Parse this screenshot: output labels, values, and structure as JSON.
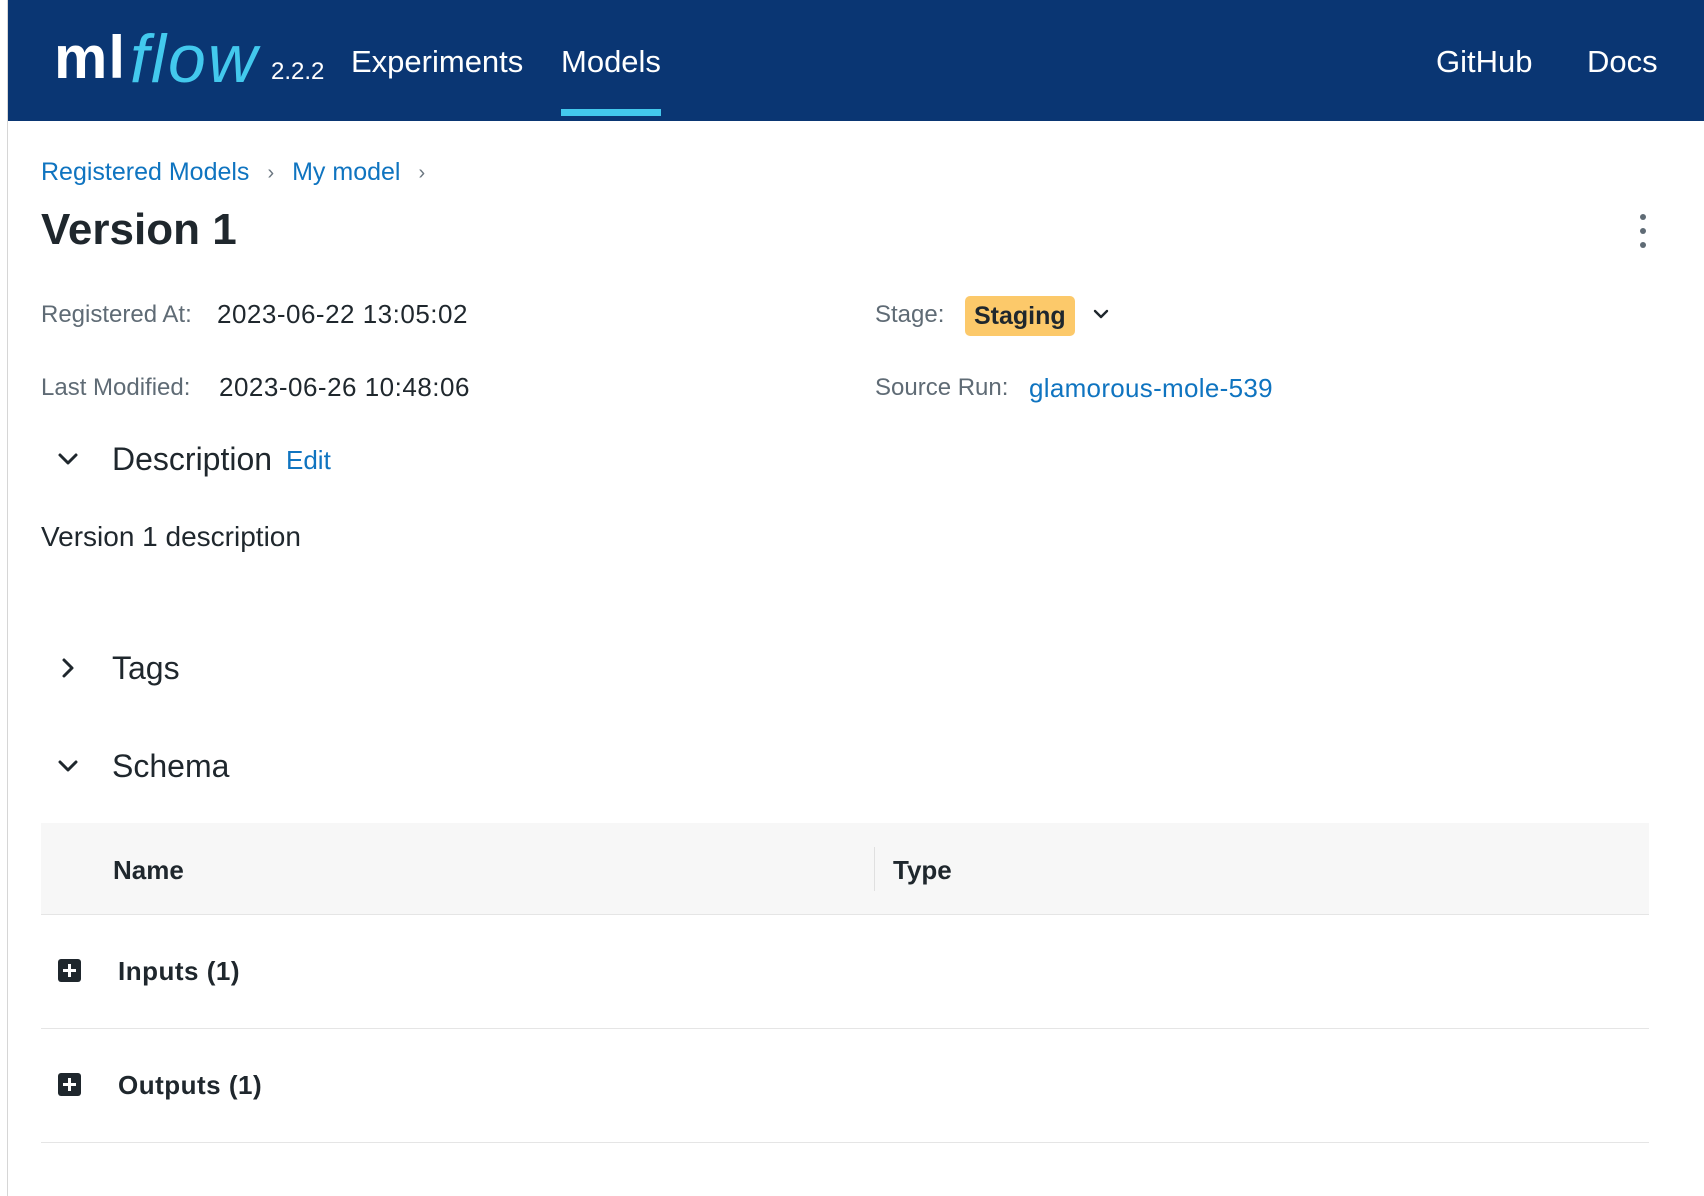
{
  "header": {
    "logo_ml": "ml",
    "logo_flow": "flow",
    "version": "2.2.2",
    "nav": {
      "experiments": "Experiments",
      "models": "Models",
      "github": "GitHub",
      "docs": "Docs"
    },
    "active_nav": "Models",
    "colors": {
      "background": "#0a3673",
      "accent": "#43c9ed"
    }
  },
  "breadcrumb": {
    "items": [
      "Registered Models",
      "My model"
    ],
    "separator_icon": "chevron-right-icon"
  },
  "page": {
    "title": "Version 1",
    "menu_icon": "kebab-menu-icon"
  },
  "metadata": {
    "registered_at_label": "Registered At:",
    "registered_at_value": "2023-06-22 13:05:02",
    "last_modified_label": "Last Modified:",
    "last_modified_value": "2023-06-26 10:48:06",
    "stage_label": "Stage:",
    "stage_value": "Staging",
    "stage_color": "#fcc96a",
    "source_run_label": "Source Run:",
    "source_run_value": "glamorous-mole-539"
  },
  "sections": {
    "description": {
      "title": "Description",
      "edit_label": "Edit",
      "expanded": true,
      "text": "Version 1 description"
    },
    "tags": {
      "title": "Tags",
      "expanded": false
    },
    "schema": {
      "title": "Schema",
      "expanded": true,
      "columns": [
        "Name",
        "Type"
      ],
      "rows": [
        {
          "label": "Inputs (1)"
        },
        {
          "label": "Outputs (1)"
        }
      ]
    }
  },
  "link_color": "#0f74c0"
}
